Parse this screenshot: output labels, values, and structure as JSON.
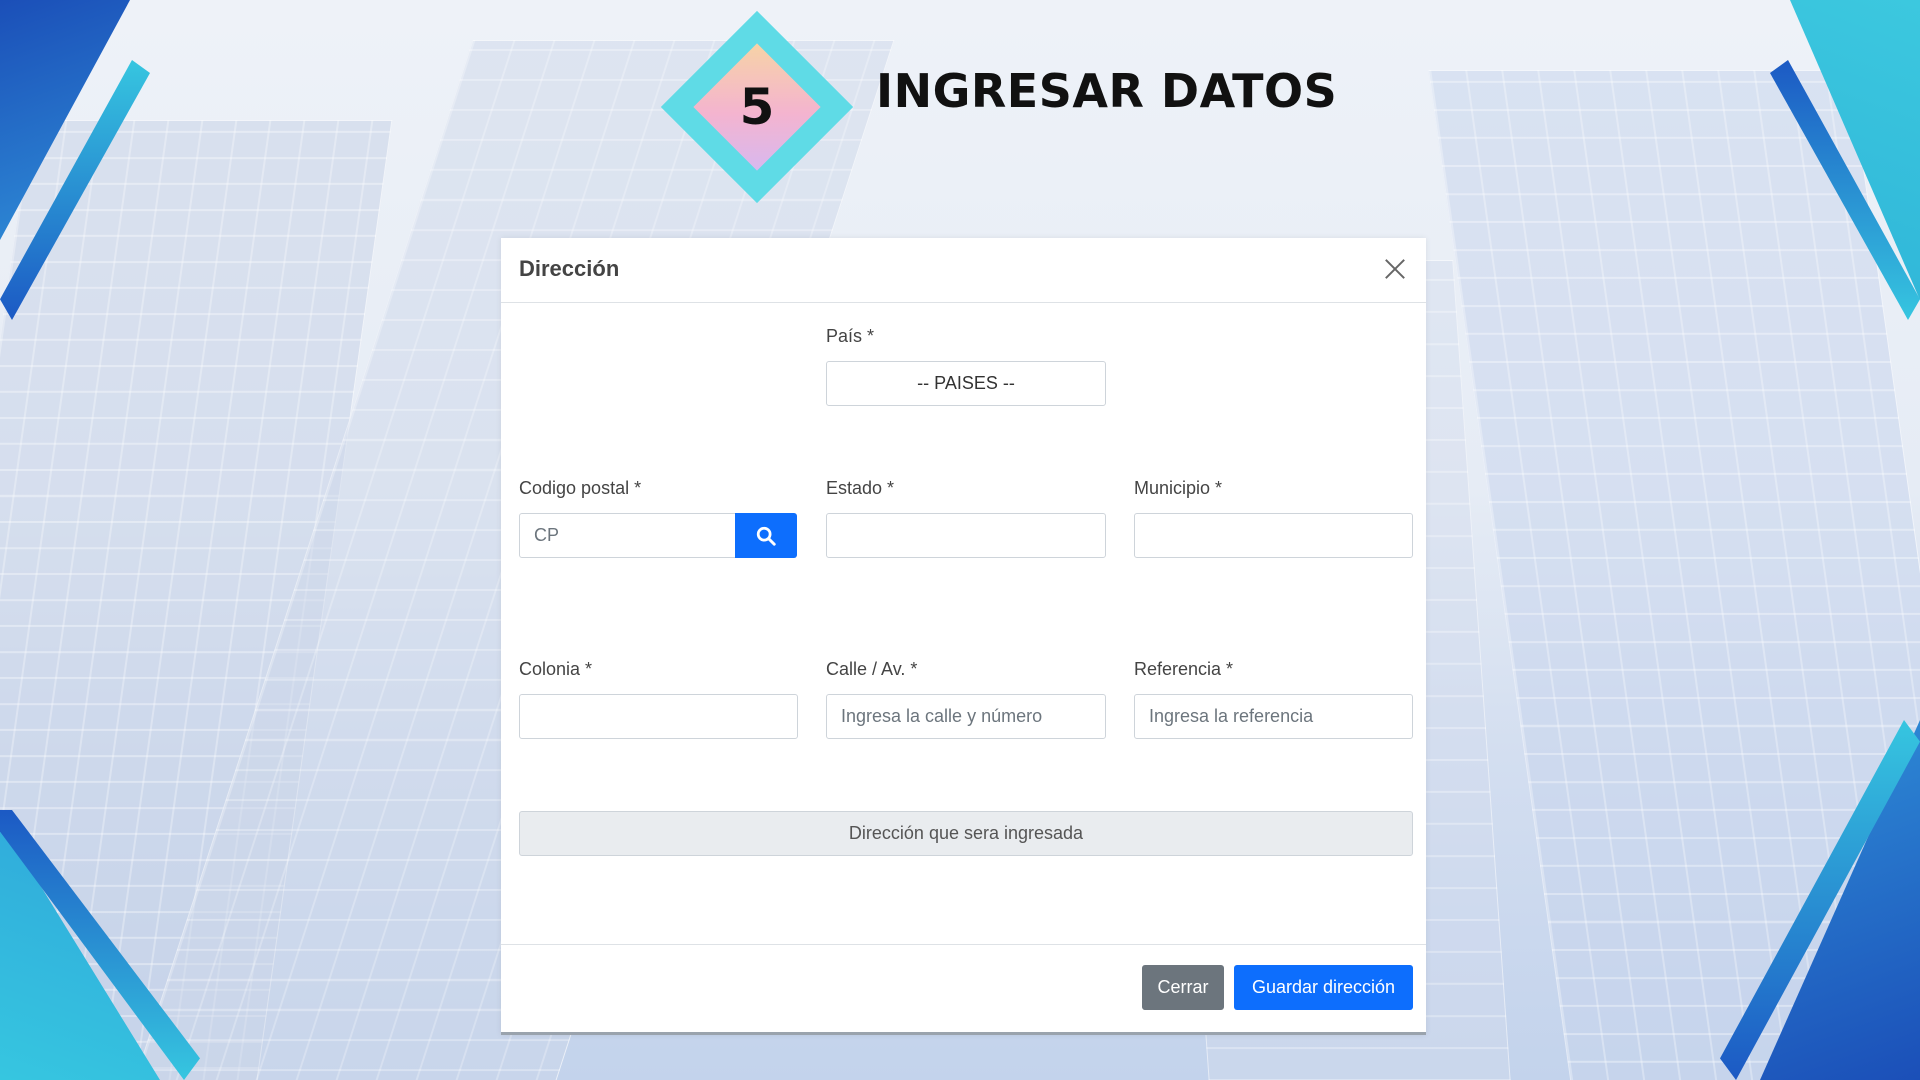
{
  "header": {
    "step_number": "5",
    "title": "INGRESAR DATOS"
  },
  "modal": {
    "title": "Dirección",
    "fields": {
      "pais": {
        "label": "País *",
        "selected": "-- PAISES --"
      },
      "codigo_postal": {
        "label": "Codigo postal *",
        "placeholder": "CP",
        "value": ""
      },
      "estado": {
        "label": "Estado *",
        "value": ""
      },
      "municipio": {
        "label": "Municipio *",
        "value": ""
      },
      "colonia": {
        "label": "Colonia *",
        "value": ""
      },
      "calle": {
        "label": "Calle / Av. *",
        "placeholder": "Ingresa la calle y número",
        "value": ""
      },
      "referencia": {
        "label": "Referencia *",
        "placeholder": "Ingresa la referencia",
        "value": ""
      }
    },
    "summary_text": "Dirección que sera ingresada",
    "buttons": {
      "close_label": "Cerrar",
      "save_label": "Guardar dirección"
    }
  },
  "colors": {
    "primary": "#0d6efd",
    "secondary": "#6c757d",
    "badge_outer": "#5fdbe6",
    "corner_accent": "#1c59c4"
  },
  "icons": [
    "close-icon",
    "search-icon"
  ]
}
